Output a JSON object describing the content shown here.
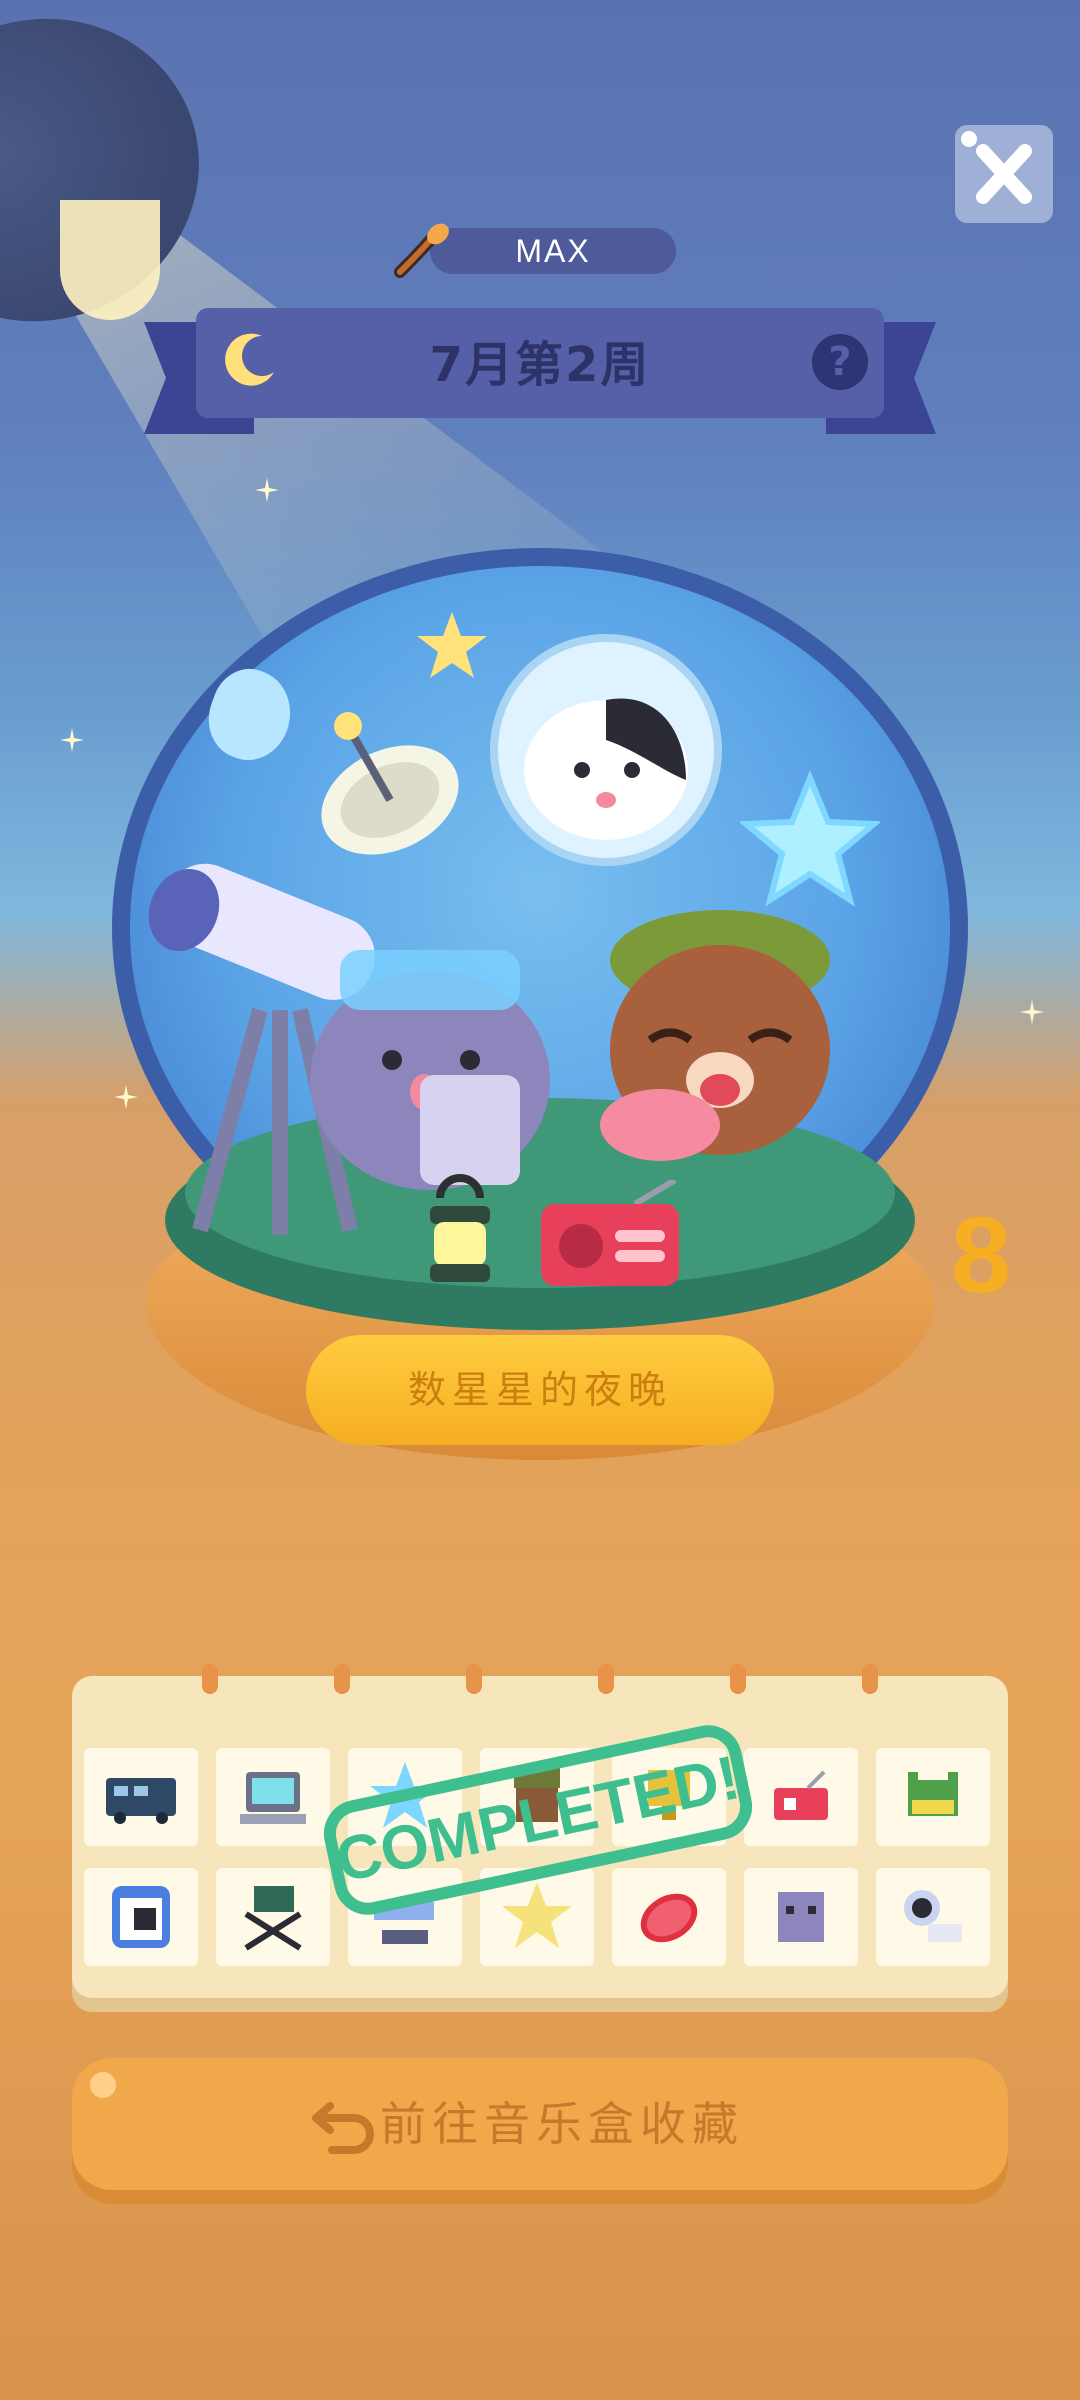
{
  "header": {
    "player_label": "MAX",
    "week_title": "7月第2周",
    "help_symbol": "?",
    "close_label": "close"
  },
  "scene": {
    "title": "数星星的夜晚",
    "badge_number": "8"
  },
  "collection": {
    "stamp_text": "COMPLETED!",
    "items_row1": [
      "bus-icon",
      "computer-icon",
      "blue-star-icon",
      "camo-cat-icon",
      "yellow-trophy-icon",
      "red-radio-icon",
      "green-frog-icon"
    ],
    "items_row2": [
      "cat-portrait-icon",
      "camp-chair-icon",
      "telescope-icon",
      "yellow-star-icon",
      "steak-icon",
      "gray-cat-icon",
      "space-cat-icon"
    ]
  },
  "footer": {
    "goto_label": "前往音乐盒收藏"
  },
  "colors": {
    "sky": "#5b72b0",
    "banner": "#5560a8",
    "ribbon": "#3c4494",
    "accent_orange": "#f1a84b",
    "card": "#f7e5bb",
    "stamp_green": "#3fbf8f",
    "plate_yellow": "#ffcc40"
  }
}
